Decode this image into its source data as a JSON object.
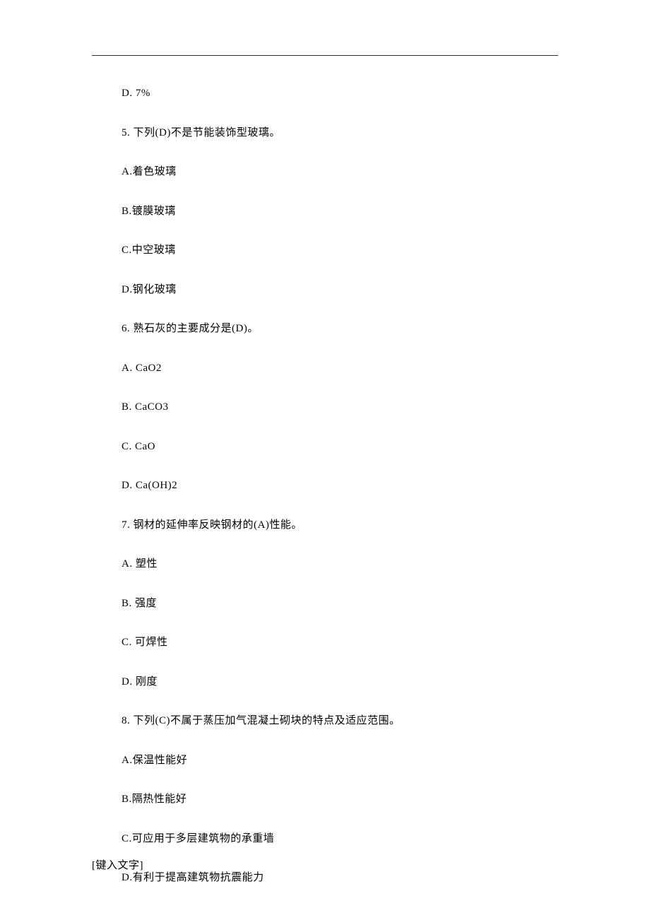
{
  "lines": [
    "D. 7%",
    "5.  下列(D)不是节能装饰型玻璃。",
    "A.着色玻璃",
    "B.镀膜玻璃",
    "C.中空玻璃",
    "D.钢化玻璃",
    "6.  熟石灰的主要成分是(D)。",
    "A. CaO2",
    "B. CaCO3",
    "C. CaO",
    "D. Ca(OH)2",
    "7.  钢材的延伸率反映钢材的(A)性能。",
    "A.  塑性",
    "B.  强度",
    "C.  可焊性",
    "D.  刚度",
    "8.  下列(C)不属于蒸压加气混凝土砌块的特点及适应范围。",
    "A.保温性能好",
    "B.隔热性能好",
    "C.可应用于多层建筑物的承重墙",
    "D.有利于提高建筑物抗震能力"
  ],
  "footer": "[键入文字]"
}
